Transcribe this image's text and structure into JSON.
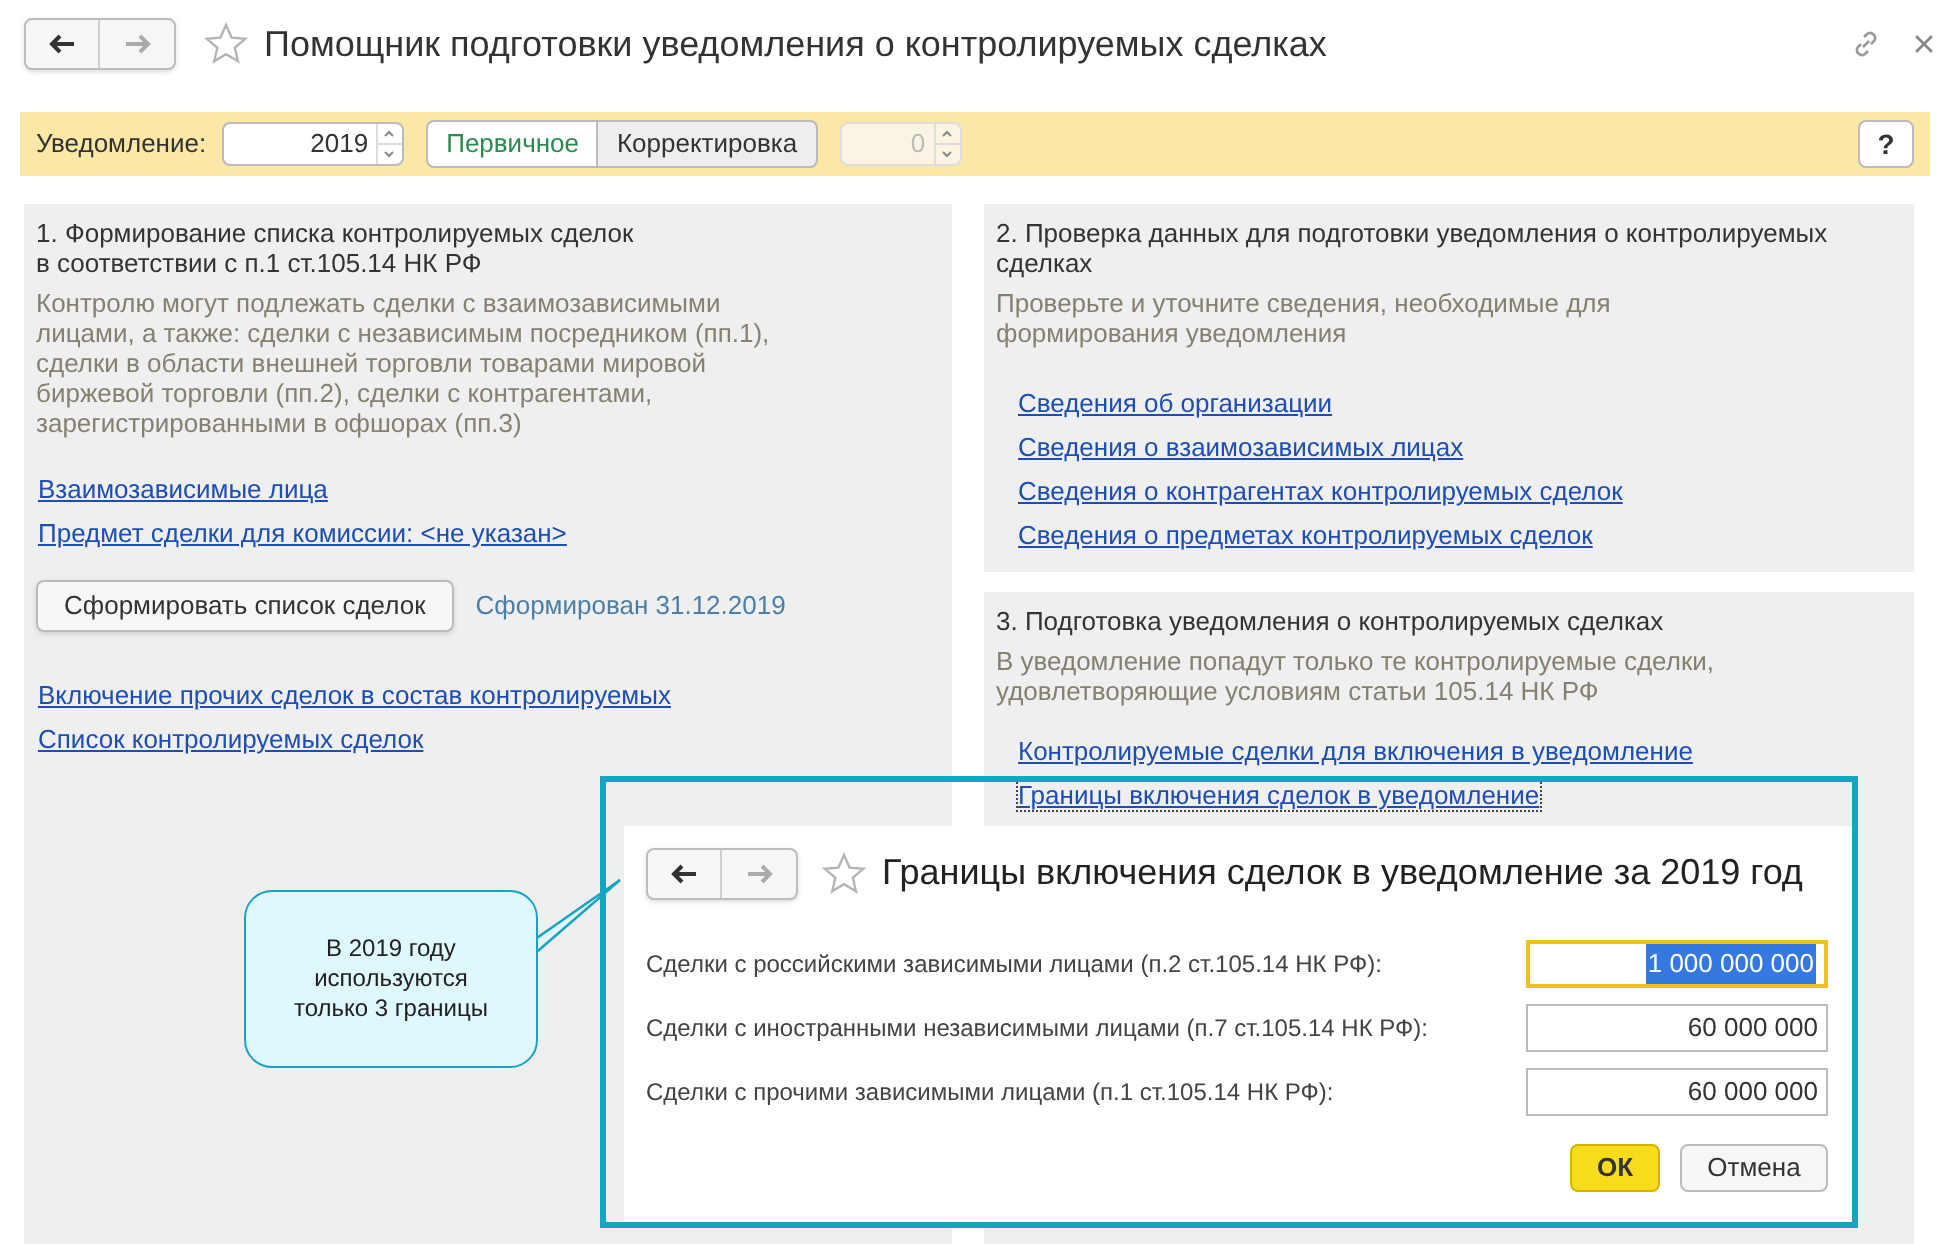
{
  "window": {
    "title": "Помощник подготовки уведомления о контролируемых сделках"
  },
  "toolbar": {
    "label": "Уведомление:",
    "year": "2019",
    "type_buttons": [
      {
        "label": "Первичное",
        "selected": true
      },
      {
        "label": "Корректировка",
        "selected": false
      }
    ],
    "correction_number": {
      "value": "0",
      "disabled": true
    },
    "help": "?"
  },
  "sections": [
    {
      "title": "1. Формирование списка контролируемых сделок\nв соответствии с п.1 ст.105.14 НК РФ",
      "description": "Контролю могут подлежать сделки с взаимозависимыми лицами, а также: сделки с независимым посредником (пп.1), сделки в области внешней торговли товарами мировой биржевой торговли (пп.2), сделки с контрагентами, зарегистрированными в офшорах (пп.3)",
      "items": [
        {
          "kind": "link",
          "text": "Взаимозависимые лица",
          "focused": false
        },
        {
          "kind": "link",
          "text": "Предмет сделки для комиссии: <не указан>",
          "focused": false
        },
        {
          "kind": "action",
          "button": "Сформировать список сделок",
          "status": "Сформирован 31.12.2019"
        },
        {
          "kind": "link",
          "text": "Включение прочих сделок в состав контролируемых",
          "focused": false
        },
        {
          "kind": "link",
          "text": "Список контролируемых сделок",
          "focused": false
        }
      ]
    },
    {
      "title": "2. Проверка данных для подготовки уведомления о контролируемых сделках",
      "description": "Проверьте и уточните сведения, необходимые для формирования уведомления",
      "items": [
        {
          "kind": "link",
          "text": "Сведения об организации",
          "focused": false
        },
        {
          "kind": "link",
          "text": "Сведения о взаимозависимых лицах",
          "focused": false
        },
        {
          "kind": "link",
          "text": "Сведения о контрагентах контролируемых сделок",
          "focused": false
        },
        {
          "kind": "link",
          "text": "Сведения о предметах контролируемых сделок",
          "focused": false
        }
      ]
    },
    {
      "title": "3. Подготовка уведомления о контролируемых сделках",
      "description": "В уведомление попадут только те контролируемые сделки, удовлетворяющие условиям статьи 105.14 НК РФ",
      "items": [
        {
          "kind": "link",
          "text": "Контролируемые сделки для включения в уведомление",
          "focused": false
        },
        {
          "kind": "link",
          "text": "Границы включения сделок в уведомление",
          "focused": true
        }
      ]
    }
  ],
  "dialog": {
    "title": "Границы включения сделок в уведомление за 2019 год",
    "fields": [
      {
        "label": "Сделки с российскими зависимыми лицами (п.2 ст.105.14 НК РФ):",
        "value": "1 000 000 000",
        "focused": true
      },
      {
        "label": "Сделки с иностранными независимыми лицами (п.7 ст.105.14 НК РФ):",
        "value": "60 000 000",
        "focused": false
      },
      {
        "label": "Сделки с прочими зависимыми лицами (п.1 ст.105.14 НК РФ):",
        "value": "60 000 000",
        "focused": false
      }
    ],
    "buttons": [
      {
        "label": "ОК",
        "kind": "primary"
      },
      {
        "label": "Отмена",
        "kind": "secondary"
      }
    ]
  },
  "callout": {
    "text": "В 2019 году\nиспользуются\nтолько 3 границы"
  }
}
